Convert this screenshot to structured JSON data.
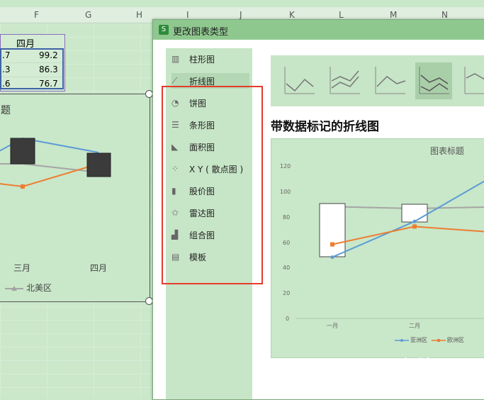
{
  "sheet": {
    "columns": [
      "F",
      "G",
      "H",
      "I",
      "J",
      "K",
      "L",
      "M",
      "N"
    ],
    "header_cell": "四月",
    "left_values": [
      ".7",
      ".3",
      ".6"
    ],
    "values": [
      "99.2",
      "86.3",
      "76.7"
    ],
    "chart": {
      "title_fragment": "题",
      "x_labels": [
        "三月",
        "四月"
      ],
      "legend_item": "北美区"
    }
  },
  "dialog": {
    "title": "更改图表类型",
    "logo": "S",
    "sidebar_items": [
      {
        "label": "柱形图",
        "icon": "bar-chart-icon"
      },
      {
        "label": "折线图",
        "icon": "line-chart-icon"
      },
      {
        "label": "饼图",
        "icon": "pie-chart-icon"
      },
      {
        "label": "条形图",
        "icon": "horizontal-bar-icon"
      },
      {
        "label": "面积图",
        "icon": "area-chart-icon"
      },
      {
        "label": "X Y ( 散点图 )",
        "icon": "scatter-icon"
      },
      {
        "label": "股价图",
        "icon": "stock-chart-icon"
      },
      {
        "label": "雷达图",
        "icon": "radar-chart-icon"
      },
      {
        "label": "组合图",
        "icon": "combo-chart-icon"
      },
      {
        "label": "模板",
        "icon": "template-icon"
      }
    ],
    "active_item": 1,
    "subtype_title": "带数据标记的折线图",
    "preview": {
      "title": "图表标题",
      "y_ticks": [
        "120",
        "100",
        "80",
        "60",
        "40",
        "20",
        "0"
      ],
      "x_labels": [
        "一月",
        "二月"
      ],
      "legend": [
        "亚洲区",
        "欧洲区"
      ]
    }
  },
  "watermark": {
    "text": "Bai 经验",
    "url": "jingyan.baidu.com"
  },
  "colors": {
    "accent_red": "#e53b2c",
    "series_blue": "#5b9bd5",
    "series_orange": "#ed7d31",
    "series_gray": "#a5a5a5"
  },
  "chart_data": {
    "type": "line",
    "categories": [
      "一月",
      "二月"
    ],
    "series": [
      {
        "name": "亚洲区",
        "values": [
          48,
          76
        ]
      },
      {
        "name": "欧洲区",
        "values": [
          58,
          72
        ]
      }
    ],
    "title": "图表标题",
    "ylim": [
      0,
      120
    ]
  }
}
